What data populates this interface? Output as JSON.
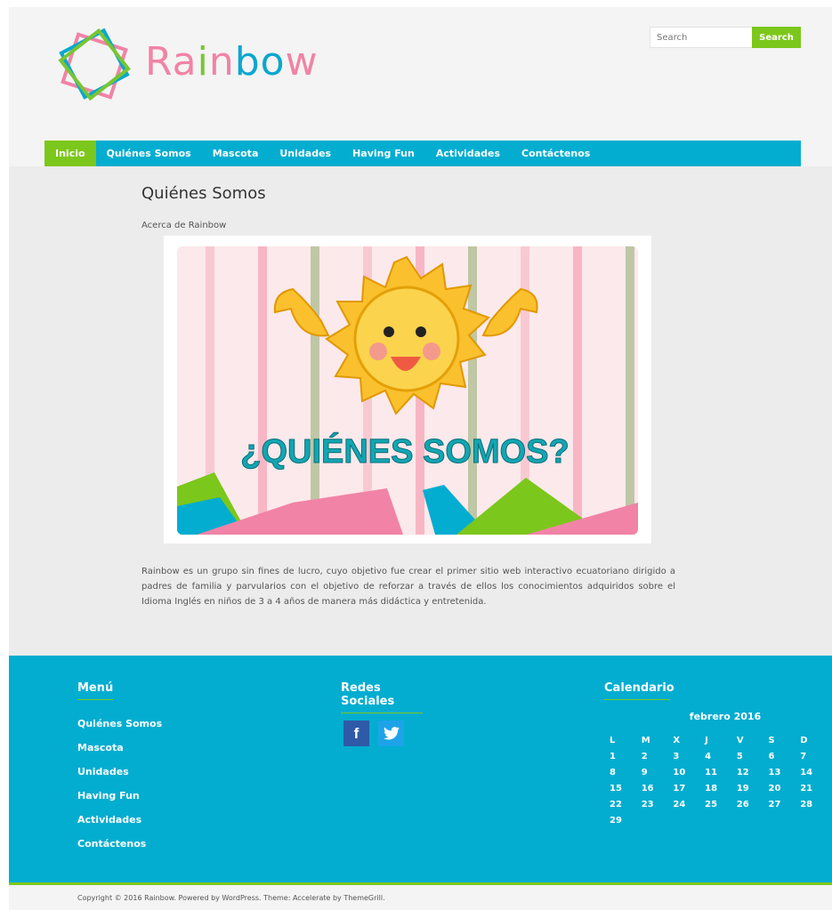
{
  "brand": {
    "name_parts": [
      {
        "text": "R",
        "color": "#f183a6"
      },
      {
        "text": "a",
        "color": "#f183a6"
      },
      {
        "text": "i",
        "color": "#79c534"
      },
      {
        "text": "n",
        "color": "#f183a6"
      },
      {
        "text": "b",
        "color": "#0aa7cf"
      },
      {
        "text": "o",
        "color": "#0aa7cf"
      },
      {
        "text": "w",
        "color": "#f183a6"
      }
    ]
  },
  "search": {
    "placeholder": "Search",
    "button_label": "Search"
  },
  "nav": {
    "items": [
      {
        "label": "Inicio",
        "active": true
      },
      {
        "label": "Quiénes Somos",
        "active": false
      },
      {
        "label": "Mascota",
        "active": false
      },
      {
        "label": "Unidades",
        "active": false
      },
      {
        "label": "Having Fun",
        "active": false
      },
      {
        "label": "Actividades",
        "active": false
      },
      {
        "label": "Contáctenos",
        "active": false
      }
    ]
  },
  "main": {
    "title": "Quiénes Somos",
    "subtitle": "Acerca de Rainbow",
    "hero_heading": "¿QUIÉNES SOMOS?",
    "body": "Rainbow es un grupo sin fines de lucro, cuyo objetivo fue crear el primer sitio web interactivo ecuatoriano dirigido a padres de familia y parvularios con el objetivo de reforzar a través de ellos los conocimientos adquiridos sobre el Idioma Inglés en niños de 3 a 4 años de manera más didáctica y entretenida."
  },
  "footer": {
    "menu_title": "Menú",
    "menu_items": [
      "Quiénes Somos",
      "Mascota",
      "Unidades",
      "Having Fun",
      "Actividades",
      "Contáctenos"
    ],
    "social_title": "Redes Sociales",
    "social": [
      {
        "name": "facebook-icon",
        "glyph": "f"
      },
      {
        "name": "twitter-icon",
        "glyph": "🐦"
      }
    ],
    "calendar_title": "Calendario",
    "calendar": {
      "caption": "febrero 2016",
      "weekdays": [
        "L",
        "M",
        "X",
        "J",
        "V",
        "S",
        "D"
      ],
      "weeks": [
        [
          "1",
          "2",
          "3",
          "4",
          "5",
          "6",
          "7"
        ],
        [
          "8",
          "9",
          "10",
          "11",
          "12",
          "13",
          "14"
        ],
        [
          "15",
          "16",
          "17",
          "18",
          "19",
          "20",
          "21"
        ],
        [
          "22",
          "23",
          "24",
          "25",
          "26",
          "27",
          "28"
        ],
        [
          "29",
          "",
          "",
          "",
          "",
          "",
          ""
        ]
      ]
    },
    "copyright": "Copyright © 2016 Rainbow. Powered by WordPress. Theme: Accelerate by ThemeGrill."
  },
  "colors": {
    "accent_blue": "#02add0",
    "accent_green": "#7cc71b"
  }
}
